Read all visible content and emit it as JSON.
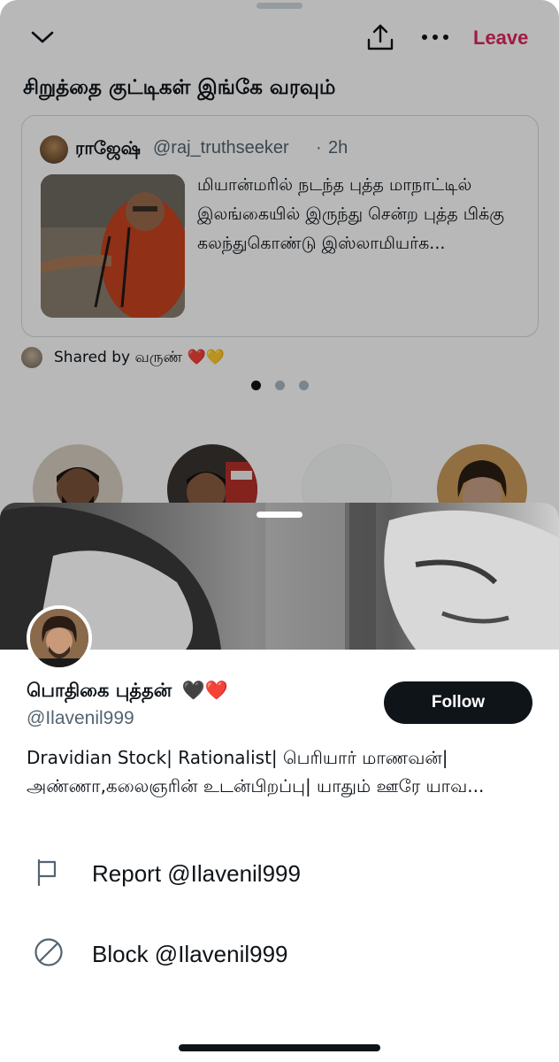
{
  "space": {
    "leave_label": "Leave",
    "title": "சிறுத்தை குட்டிகள் இங்கே வரவும்",
    "pinned_tweet": {
      "author_name": "ராஜேஷ்",
      "author_handle": "@raj_truthseeker",
      "separator": "·",
      "time": "2h",
      "text": "மியான்மரில் நடந்த புத்த மாநாட்டில் இலங்கையில் இருந்து சென்ற புத்த பிக்கு கலந்துகொண்டு இஸ்லாமியர்க..."
    },
    "shared_by": "Shared by வருண் ❤️💛",
    "carousel": {
      "pages": 3,
      "active": 1
    }
  },
  "profile": {
    "name": "பொதிகை புத்தன்",
    "name_emoji": "🖤❤️",
    "handle": "@Ilavenil999",
    "follow_label": "Follow",
    "bio": "Dravidian Stock| Rationalist| பெரியார் மாணவன்| அண்ணா,கலைஞரின் உடன்பிறப்பு| யாதும் ஊரே யாவ..."
  },
  "actions": {
    "report_label": "Report @Ilavenil999",
    "block_label": "Block @Ilavenil999"
  },
  "icons": {
    "collapse": "chevron-down-icon",
    "share": "share-icon",
    "more": "more-icon",
    "report": "flag-icon",
    "block": "block-icon"
  },
  "colors": {
    "leave": "#e0245e",
    "follow_bg": "#0f1419",
    "secondary_text": "#536471"
  }
}
